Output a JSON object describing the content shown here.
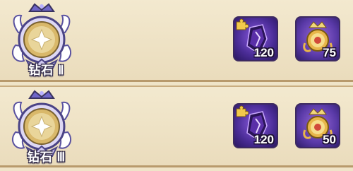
{
  "rows": [
    {
      "rank_label": "钻石 Ⅱ",
      "rewards": [
        {
          "icon": "hero-fragment-crystal-icon",
          "count": "120"
        },
        {
          "icon": "gold-medal-icon",
          "count": "75"
        }
      ]
    },
    {
      "rank_label": "钻石 Ⅲ",
      "rewards": [
        {
          "icon": "hero-fragment-crystal-icon",
          "count": "120"
        },
        {
          "icon": "gold-medal-icon",
          "count": "50"
        }
      ]
    }
  ],
  "colors": {
    "background": "#efe4c8",
    "crystal_frame": "#4a2c96",
    "medal_frame": "#5a3aa8",
    "gold": "#e8b54a"
  }
}
